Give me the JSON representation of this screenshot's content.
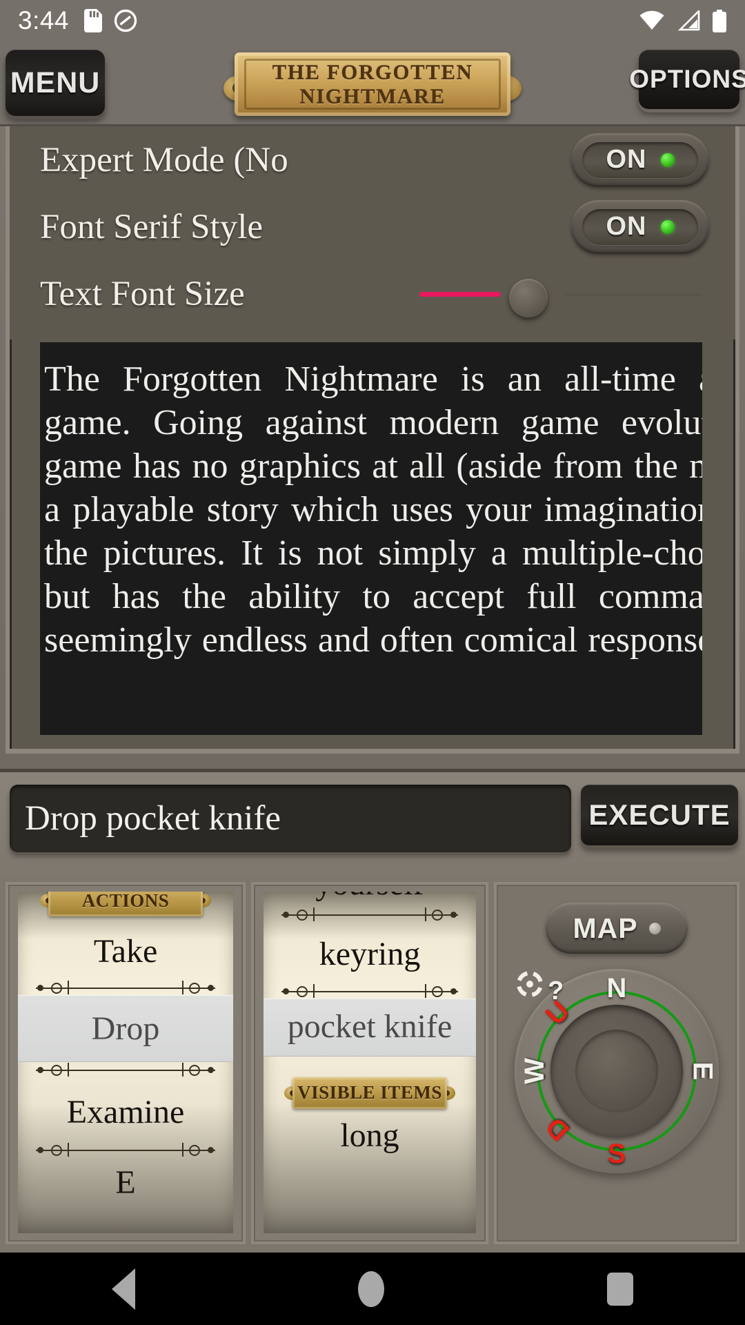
{
  "status_bar": {
    "time": "3:44",
    "left_icons": [
      "sd-card-icon",
      "do-not-disturb-icon"
    ],
    "right_icons": [
      "wifi-icon",
      "cell-signal-icon",
      "battery-icon"
    ]
  },
  "top_bar": {
    "menu_label": "MENU",
    "options_label": "OPTIONS",
    "title_line1": "THE FORGOTTEN",
    "title_line2": "NIGHTMARE"
  },
  "settings": [
    {
      "label": "Expert Mode (No",
      "control": "toggle",
      "value": "ON",
      "led_color": "#3cc21e"
    },
    {
      "label": "Font Serif Style",
      "control": "toggle",
      "value": "ON",
      "led_color": "#3cc21e"
    },
    {
      "label": "Text Font Size",
      "control": "slider",
      "fill_color": "#e8195f",
      "value_percent": 31
    }
  ],
  "story": {
    "text": "The Forgotten Nightmare is an all-time adventure game. Going against modern game evolution, this game has no graphics at all (aside from the map). It is a playable story which uses your imagination to paint the pictures. It is not simply a multiple-choice game but has the ability to accept full commands with seemingly endless and often comical responses."
  },
  "command_bar": {
    "input_value": "Drop pocket knife",
    "execute_label": "EXECUTE"
  },
  "actions_panel": {
    "header": "ACTIONS",
    "items": [
      {
        "label": "Take",
        "selected": false
      },
      {
        "label": "Drop",
        "selected": true
      },
      {
        "label": "Examine",
        "selected": false
      }
    ],
    "clipped_bottom_item": "E"
  },
  "items_panel": {
    "header": "VISIBLE ITEMS",
    "clipped_top_item": "yourself",
    "items": [
      {
        "label": "keyring",
        "selected": false
      },
      {
        "label": "pocket knife",
        "selected": true
      }
    ],
    "items_after_header": [
      {
        "label": "long",
        "selected": false
      }
    ]
  },
  "nav_panel": {
    "map_label": "MAP",
    "compass": {
      "north": "N",
      "east": "E",
      "south": "S",
      "west": "W",
      "up": "U",
      "down": "D",
      "look_icon": "look-target-icon",
      "help": "?",
      "ring_color": "#149a14",
      "white_color": "#f2f0eb",
      "red_color": "#e22215"
    }
  },
  "android_nav": {
    "back": "back-triangle-icon",
    "home": "home-circle-icon",
    "recents": "recents-square-icon"
  }
}
